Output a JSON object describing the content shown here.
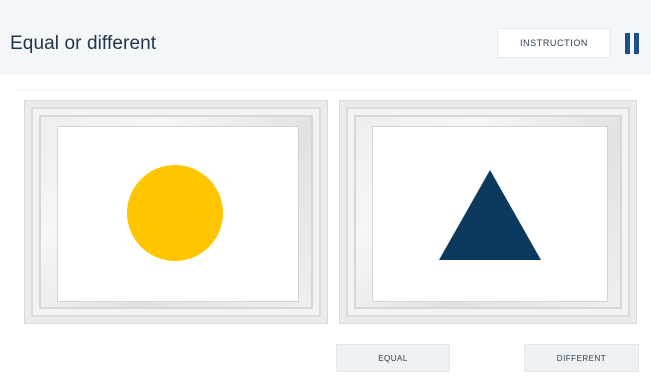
{
  "header": {
    "title": "Equal or different",
    "instruction_label": "INSTRUCTION",
    "pause_icon": "pause-icon"
  },
  "stimuli": {
    "left": {
      "shape": "circle",
      "color": "#FFC600"
    },
    "right": {
      "shape": "triangle",
      "color": "#0C3A5E"
    }
  },
  "answers": {
    "equal_label": "EQUAL",
    "different_label": "DIFFERENT"
  },
  "colors": {
    "header_bg": "#F3F7F9",
    "accent": "#1D4F86",
    "button_bg": "#EEF2F4"
  }
}
